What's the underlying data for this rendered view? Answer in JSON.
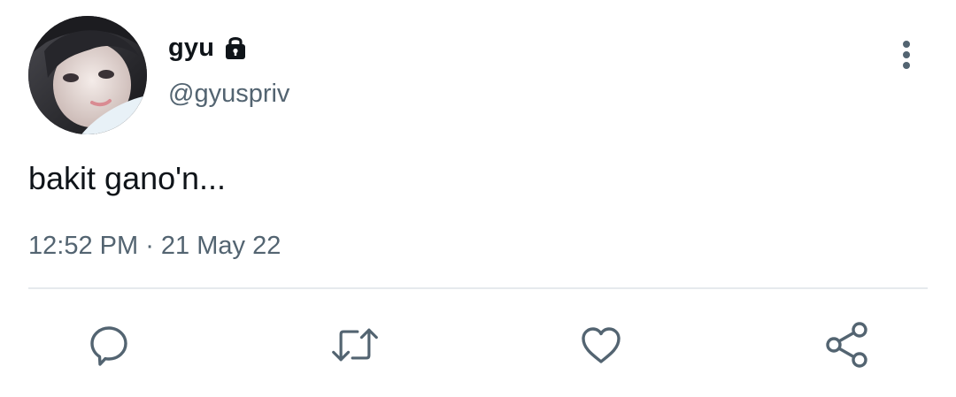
{
  "user": {
    "display_name": "gyu",
    "handle": "@gyuspriv",
    "protected": true
  },
  "tweet": {
    "text": "bakit gano'n...",
    "time": "12:52 PM",
    "separator": " · ",
    "date": "21 May 22"
  },
  "icons": {
    "lock": "lock-icon",
    "more": "more-vertical-icon",
    "reply": "reply-icon",
    "retweet": "retweet-icon",
    "like": "heart-icon",
    "share": "share-icon"
  },
  "colors": {
    "text_primary": "#0f1419",
    "text_secondary": "#536471",
    "icon": "#536471",
    "divider": "#e6eaed",
    "background": "#ffffff"
  }
}
